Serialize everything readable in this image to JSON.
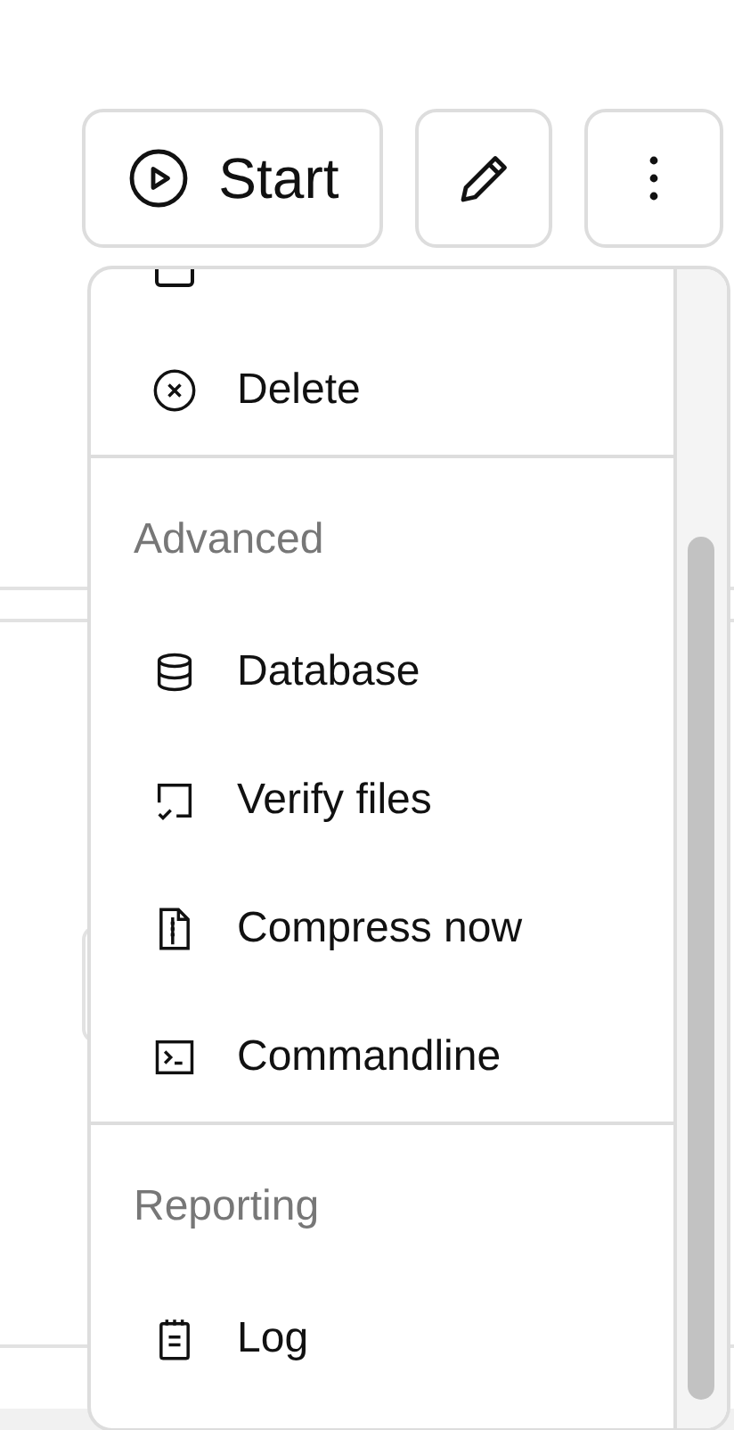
{
  "toolbar": {
    "start_label": "Start"
  },
  "menu": {
    "sections": [
      {
        "items": [
          {
            "label": "Delete",
            "kind": "circle-x"
          }
        ]
      },
      {
        "header": "Advanced",
        "items": [
          {
            "label": "Database",
            "kind": "database"
          },
          {
            "label": "Verify files",
            "kind": "verify"
          },
          {
            "label": "Compress now",
            "kind": "archive"
          },
          {
            "label": "Commandline",
            "kind": "terminal"
          }
        ]
      },
      {
        "header": "Reporting",
        "items": [
          {
            "label": "Log",
            "kind": "log"
          }
        ]
      }
    ]
  }
}
